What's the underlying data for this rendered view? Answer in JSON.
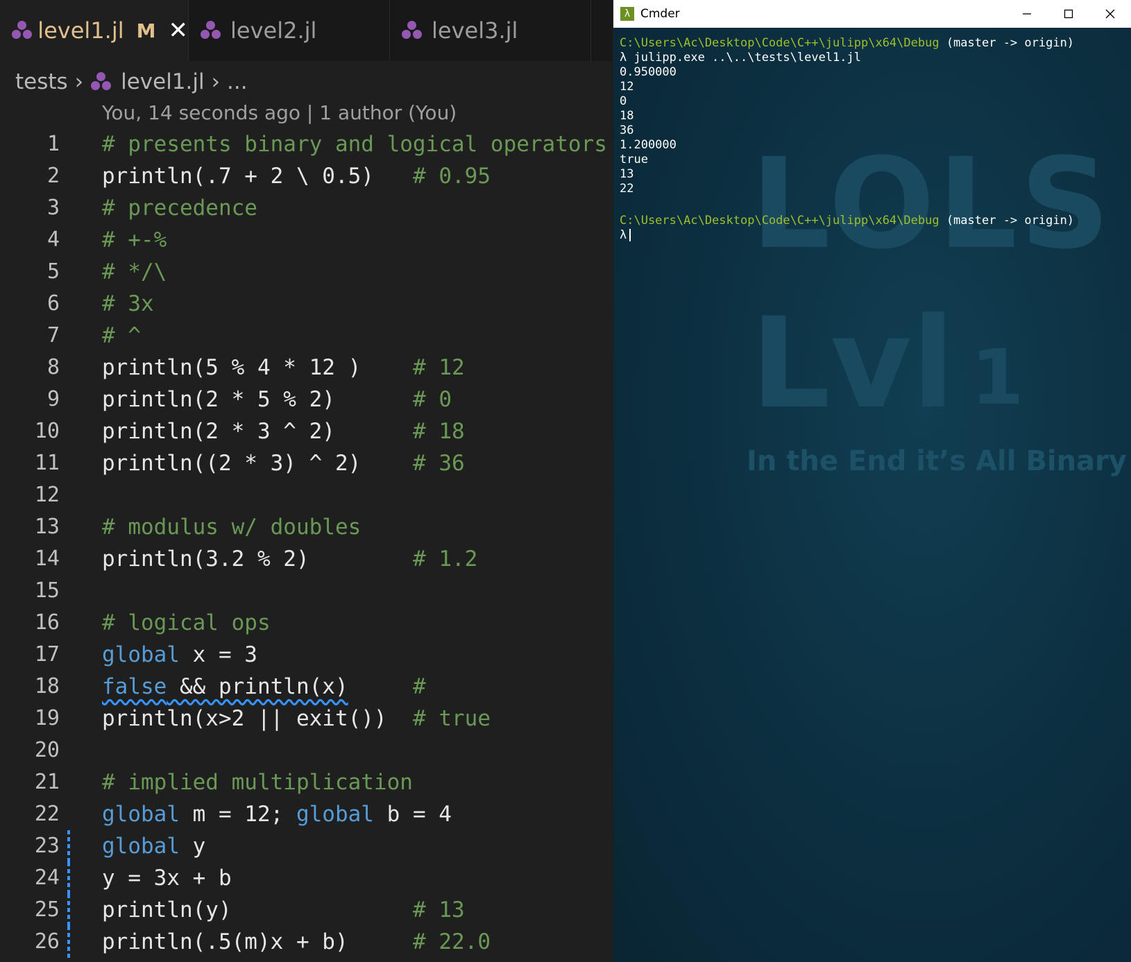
{
  "editor": {
    "tabs": [
      {
        "label": "level1.jl",
        "modified": "M",
        "active": true
      },
      {
        "label": "level2.jl",
        "active": false
      },
      {
        "label": "level3.jl",
        "active": false
      }
    ],
    "breadcrumb": {
      "folder": "tests",
      "file": "level1.jl",
      "more": "..."
    },
    "blame": "You, 14 seconds ago | 1 author (You)",
    "lines": [
      {
        "n": "1",
        "code": "# presents binary and logical operators",
        "comment": ""
      },
      {
        "n": "2",
        "code": "println(.7 + 2 \\ 0.5)",
        "comment": "# 0.95"
      },
      {
        "n": "3",
        "code": "# precedence",
        "comment": ""
      },
      {
        "n": "4",
        "code": "# +-%",
        "comment": ""
      },
      {
        "n": "5",
        "code": "# */\\",
        "comment": ""
      },
      {
        "n": "6",
        "code": "# 3x",
        "comment": ""
      },
      {
        "n": "7",
        "code": "# ^",
        "comment": ""
      },
      {
        "n": "8",
        "code": "println(5 % 4 * 12 )",
        "comment": "# 12"
      },
      {
        "n": "9",
        "code": "println(2 * 5 % 2)",
        "comment": "# 0"
      },
      {
        "n": "10",
        "code": "println(2 * 3 ^ 2)",
        "comment": "# 18"
      },
      {
        "n": "11",
        "code": "println((2 * 3) ^ 2)",
        "comment": "# 36"
      },
      {
        "n": "12",
        "code": "",
        "comment": ""
      },
      {
        "n": "13",
        "code": "# modulus w/ doubles",
        "comment": ""
      },
      {
        "n": "14",
        "code": "println(3.2 % 2)",
        "comment": "# 1.2"
      },
      {
        "n": "15",
        "code": "",
        "comment": ""
      },
      {
        "n": "16",
        "code": "# logical ops",
        "comment": ""
      },
      {
        "n": "17",
        "kw": "global",
        "code": " x = 3",
        "comment": ""
      },
      {
        "n": "18",
        "kw": "false",
        "code": " && println(x)",
        "comment": "#"
      },
      {
        "n": "19",
        "code": "println(x>2 || exit())",
        "comment": "# true"
      },
      {
        "n": "20",
        "code": "",
        "comment": ""
      },
      {
        "n": "21",
        "code": "# implied multiplication",
        "comment": ""
      },
      {
        "n": "22",
        "kw": "global",
        "code": " m = 12; ",
        "kw2": "global",
        "code2": " b = 4",
        "comment": ""
      },
      {
        "n": "23",
        "kw": "global",
        "code": " y",
        "comment": ""
      },
      {
        "n": "24",
        "code": "y = 3x + b",
        "comment": ""
      },
      {
        "n": "25",
        "code": "println(y)",
        "comment": "# 13"
      },
      {
        "n": "26",
        "code": "println(.5(m)x + b)",
        "comment": "# 22.0"
      }
    ]
  },
  "terminal": {
    "title": "Cmder",
    "app_icon": "λ",
    "window_buttons": [
      "minimize-icon",
      "maximize-icon",
      "close-icon"
    ],
    "prompt_path": "C:\\Users\\Ac\\Desktop\\Code\\C++\\julipp\\x64\\Debug",
    "prompt_branch": " (master -> origin)",
    "command": "λ julipp.exe ..\\..\\tests\\level1.jl",
    "output": [
      "0.950000",
      "12",
      "0",
      "18",
      "36",
      "1.200000",
      "true",
      "13",
      "22"
    ],
    "prompt_symbol": "λ",
    "wallpaper": {
      "title": "LOLS",
      "level": "Lvl",
      "number": "1",
      "tagline": "In the End it’s All Binary"
    }
  }
}
